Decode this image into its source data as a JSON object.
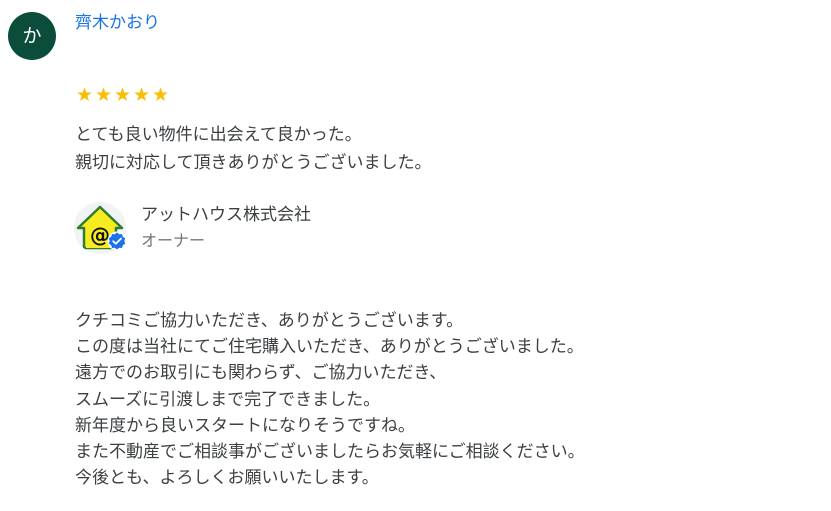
{
  "reviewer": {
    "initial": "か",
    "name": "齊木かおり",
    "avatar_color": "#0b4d3a"
  },
  "rating": {
    "stars": 5,
    "max": 5,
    "star_color": "#fbbc04"
  },
  "review": {
    "lines": [
      "とても良い物件に出会えて良かった。",
      "親切に対応して頂きありがとうございました。"
    ]
  },
  "owner": {
    "logo_icon": "house-at-sign-icon",
    "verified_icon": "verified-check-icon",
    "name": "アットハウス株式会社",
    "role": "オーナー"
  },
  "reply": {
    "lines": [
      "クチコミご協力いただき、ありがとうございます。",
      "この度は当社にてご住宅購入いただき、ありがとうございました。",
      "遠方でのお取引にも関わらず、ご協力いただき、",
      "スムーズに引渡しまで完了できました。",
      "新年度から良いスタートになりそうですね。",
      "また不動産でご相談事がございましたらお気軽にご相談ください。",
      "今後とも、よろしくお願いいたします。"
    ]
  }
}
